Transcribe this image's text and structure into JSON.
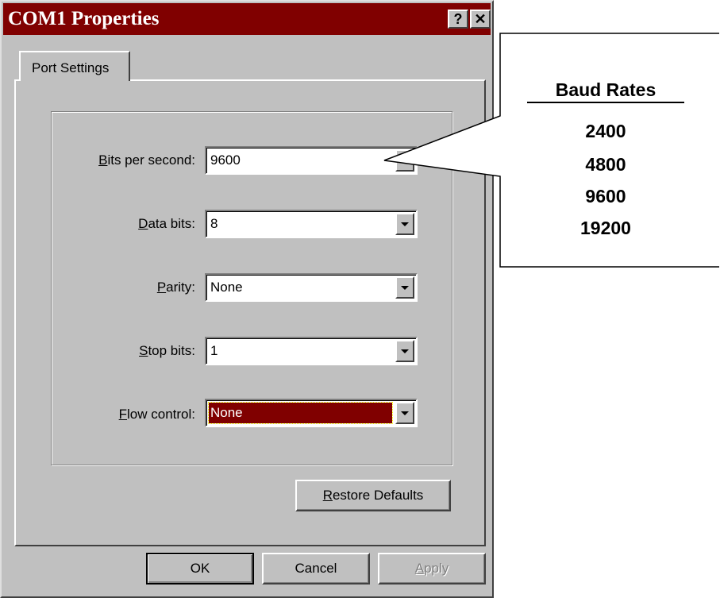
{
  "window": {
    "title": "COM1 Properties"
  },
  "title_buttons": {
    "help": "?",
    "close": "✕"
  },
  "tabs": [
    {
      "label": "Port Settings",
      "active": true
    }
  ],
  "fields": [
    {
      "label_mnemonic": "B",
      "label_rest": "its per second:",
      "value": "9600"
    },
    {
      "label_mnemonic": "D",
      "label_rest": "ata bits:",
      "value": "8"
    },
    {
      "label_mnemonic": "P",
      "label_rest": "arity:",
      "value": "None"
    },
    {
      "label_mnemonic": "S",
      "label_rest": "top bits:",
      "value": "1"
    },
    {
      "label_mnemonic": "F",
      "label_rest": "low control:",
      "value": "None"
    }
  ],
  "restore_button": {
    "mnemonic": "R",
    "rest": "estore Defaults"
  },
  "footer_buttons": {
    "ok": "OK",
    "cancel": "Cancel",
    "apply_mnemonic": "A",
    "apply_rest": "pply"
  },
  "callout": {
    "title": "Baud Rates",
    "items": [
      "2400",
      "4800",
      "9600",
      "19200"
    ]
  },
  "colors": {
    "title_bar": "#800000",
    "dialog_face": "#c0c0c0",
    "selection": "#800000"
  }
}
